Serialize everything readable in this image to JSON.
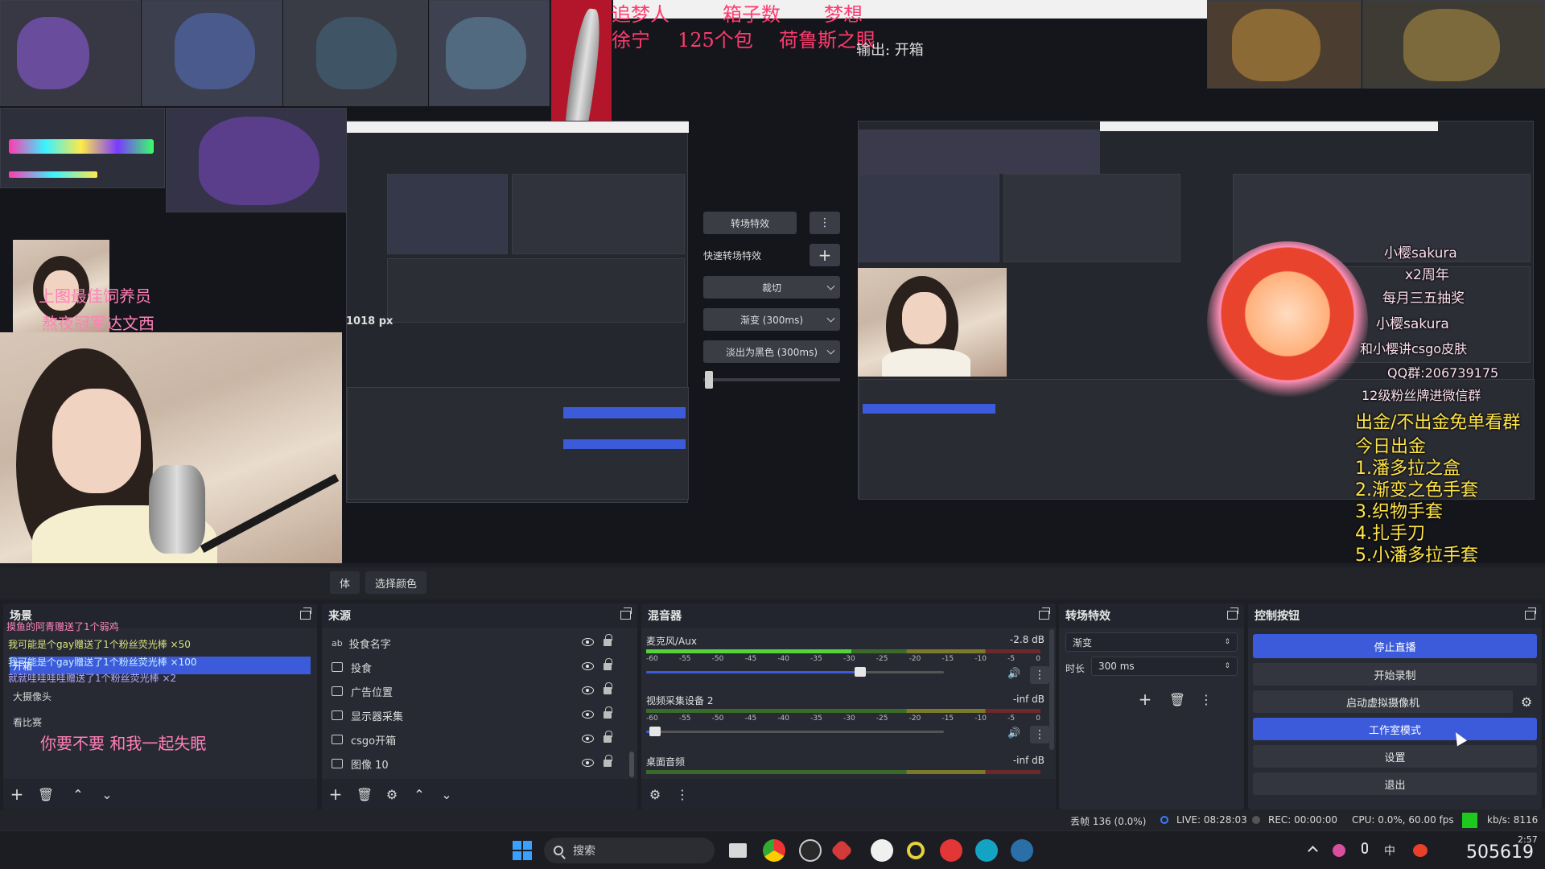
{
  "preview": {
    "overlay_left_lines": [
      "追梦人",
      "箱子数",
      "梦想"
    ],
    "overlay_row2": [
      "徐宁",
      "125个包",
      "荷鲁斯之眼"
    ],
    "output_label": "输出: 开箱",
    "nested_label": "1018 px",
    "left_overlay_1": "上图最佳饲养员",
    "left_overlay_2": "熬夜冠军达文西",
    "right_overlay_lines": [
      "出金/不出金免单看群",
      "今日出金",
      "1.潘多拉之盒",
      "2.渐变之色手套",
      "3.织物手套",
      "4.扎手刀",
      "5.小潘多拉手套"
    ],
    "sticker_lines": [
      "小樱sakura",
      "x2周年",
      "每月三五抽奖",
      "小樱sakura",
      "和小樱讲csgo皮肤",
      "QQ群:206739175",
      "12级粉丝牌进微信群"
    ],
    "corner_watermark": "505619"
  },
  "transitions_panel": {
    "title": "转场特效",
    "quick": "快速转场特效",
    "items": [
      "裁切",
      "渐变 (300ms)",
      "淡出为黑色 (300ms)"
    ]
  },
  "filter_bar": {
    "button_1": "选择颜色",
    "button_0": "体"
  },
  "scenes": {
    "title": "场景",
    "items": [
      "开箱",
      "大摄像头",
      "看比赛"
    ],
    "chat": [
      "摸鱼的阿青赠送了1个弱鸡",
      "我可能是个gay赠送了1个粉丝荧光棒 ×50",
      "我可能是个gay赠送了1个粉丝荧光棒 ×100",
      "就就哇哇哇哇赠送了1个粉丝荧光棒 ×2"
    ],
    "overlay_text": "你要不要 和我一起失眠"
  },
  "sources": {
    "title": "来源",
    "items": [
      "投食名字",
      "投食",
      "广告位置",
      "显示器采集",
      "csgo开箱",
      "图像 10"
    ]
  },
  "mixer": {
    "title": "混音器",
    "channels": [
      {
        "name": "麦克风/Aux",
        "db": "-2.8 dB",
        "level": 0.72
      },
      {
        "name": "视频采集设备 2",
        "db": "-inf dB",
        "level": 0.03
      },
      {
        "name": "桌面音频",
        "db": "-inf dB",
        "level": 0
      }
    ],
    "scale": [
      "-60",
      "-55",
      "-50",
      "-45",
      "-40",
      "-35",
      "-30",
      "-25",
      "-20",
      "-15",
      "-10",
      "-5",
      "0"
    ]
  },
  "transition_effects": {
    "title": "转场特效",
    "selected": "渐变",
    "duration_label": "时长",
    "duration_value": "300 ms"
  },
  "controls": {
    "title": "控制按钮",
    "buttons": [
      "停止直播",
      "开始录制",
      "启动虚拟摄像机",
      "工作室模式",
      "设置",
      "退出"
    ]
  },
  "status": {
    "dropped": "丢帧 136 (0.0%)",
    "live": "LIVE: 08:28:03",
    "rec": "REC: 00:00:00",
    "cpu": "CPU: 0.0%, 60.00 fps",
    "kbs": "kb/s: 8116"
  },
  "taskbar": {
    "search_placeholder": "搜索",
    "ime": "中",
    "time": "2:57"
  },
  "colors": {
    "accent": "#3b5bdb",
    "dock_bg": "#272a33",
    "overlay_red": "#ff3b6f",
    "overlay_yellow": "#ffe44a",
    "status_green": "#1ec81e"
  }
}
